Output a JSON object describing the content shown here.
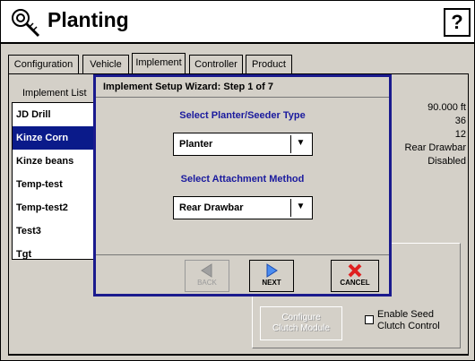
{
  "header": {
    "title": "Planting",
    "help_label": "?"
  },
  "tabs": [
    {
      "label": "Configuration",
      "active": false
    },
    {
      "label": "Vehicle",
      "active": false
    },
    {
      "label": "Implement",
      "active": true
    },
    {
      "label": "Controller",
      "active": false
    },
    {
      "label": "Product",
      "active": false
    }
  ],
  "implement_list": {
    "label": "Implement List",
    "items": [
      "JD Drill",
      "Kinze Corn",
      "Kinze beans",
      "Temp-test",
      "Temp-test2",
      "Test3",
      "Tgt"
    ],
    "selected": "Kinze Corn"
  },
  "properties": [
    "90.000 ft",
    "36",
    "12",
    "Rear Drawbar",
    "Disabled"
  ],
  "wizard": {
    "title": "Implement Setup Wizard: Step 1 of 7",
    "type_prompt": "Select Planter/Seeder Type",
    "type_value": "Planter",
    "attach_prompt": "Select Attachment Method",
    "attach_value": "Rear Drawbar",
    "buttons": {
      "back": "BACK",
      "next": "NEXT",
      "cancel": "CANCEL"
    }
  },
  "clutch": {
    "configure_label_1": "Configure",
    "configure_label_2": "Clutch Module",
    "enable_label_1": "Enable Seed",
    "enable_label_2": "Clutch Control",
    "enable_checked": false
  },
  "colors": {
    "selection": "#0a1a8a",
    "wizard_border": "#1a1a8e",
    "prompt_text": "#1a1a9e",
    "cancel_icon": "#e02020",
    "next_icon": "#3a7be0"
  }
}
